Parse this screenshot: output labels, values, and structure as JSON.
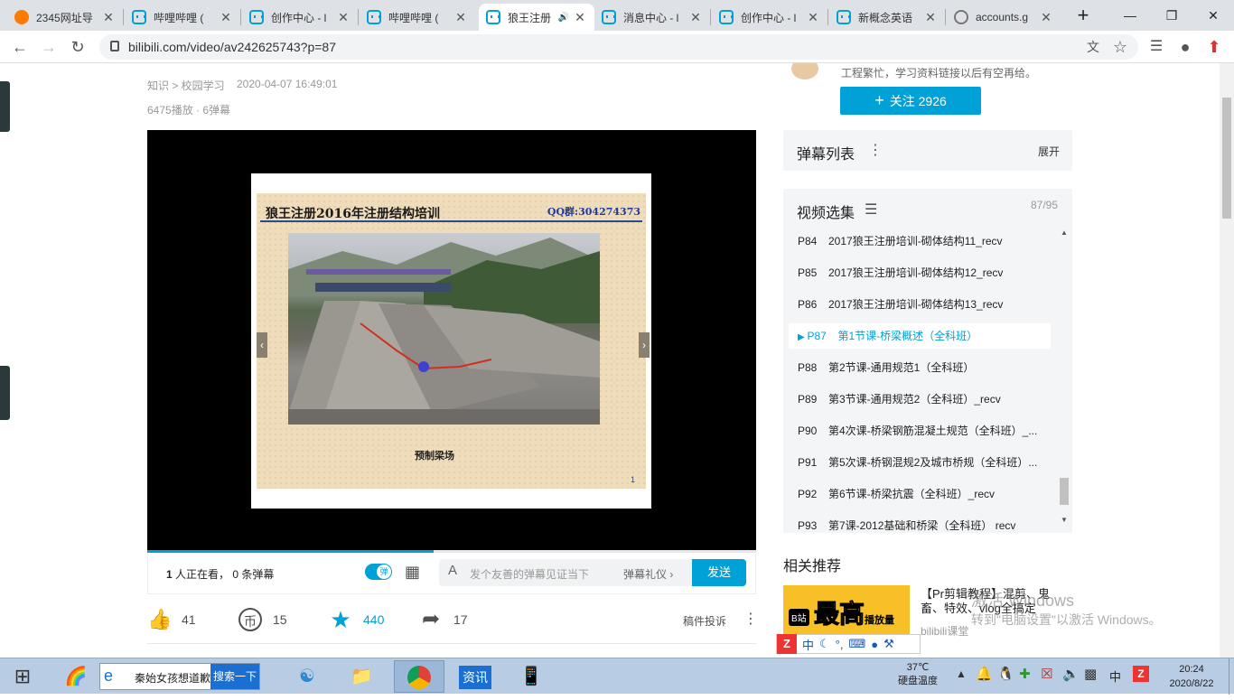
{
  "browser": {
    "tabs": [
      {
        "title": "2345网址导",
        "icon": "2345-icon"
      },
      {
        "title": "哔哩哔哩 (",
        "icon": "bilibili-icon"
      },
      {
        "title": "创作中心 - l",
        "icon": "bilibili-icon"
      },
      {
        "title": "哔哩哔哩 (",
        "icon": "bilibili-icon"
      },
      {
        "title": "狼王注册",
        "icon": "bilibili-icon",
        "active": true
      },
      {
        "title": "消息中心 - l",
        "icon": "bilibili-icon"
      },
      {
        "title": "创作中心 - l",
        "icon": "bilibili-icon"
      },
      {
        "title": "新概念英语",
        "icon": "bilibili-icon"
      },
      {
        "title": "accounts.g",
        "icon": "globe-icon"
      }
    ],
    "new_tab": "+",
    "url": "bilibili.com/video/av242625743?p=87"
  },
  "video": {
    "category": "知识 > 校园学习",
    "date": "2020-04-07 16:49:01",
    "stats": "6475播放 · 6弹幕",
    "slide": {
      "title": "狼王注册2016年注册结构培训",
      "qq": "QQ群:304274373",
      "caption": "预制梁场",
      "page": "1"
    },
    "progress": 0.47
  },
  "danmaku_bar": {
    "viewers": "1",
    "viewers_text": " 人正在看， ",
    "count_text": "0 条弹幕",
    "toggle": "弹",
    "placeholder": "发个友善的弹幕见证当下",
    "etiquette": "弹幕礼仪",
    "send": "发送"
  },
  "actions": {
    "like": "41",
    "coin": "15",
    "favorite": "440",
    "share": "17",
    "report": "稿件投诉"
  },
  "uploader": {
    "desc": "工程繁忙，学习资料链接以后有空再给。",
    "follow": "关注 2926"
  },
  "danmaku_list": {
    "title": "弹幕列表",
    "expand": "展开"
  },
  "episodes": {
    "title": "视频选集",
    "count": "87/95",
    "items": [
      {
        "p": "P84",
        "name": "2017狼王注册培训-砌体结构11_recv"
      },
      {
        "p": "P85",
        "name": "2017狼王注册培训-砌体结构12_recv"
      },
      {
        "p": "P86",
        "name": "2017狼王注册培训-砌体结构13_recv"
      },
      {
        "p": "P87",
        "name": "第1节课-桥梁概述（全科班）",
        "active": true
      },
      {
        "p": "P88",
        "name": "第2节课-通用规范1（全科班）"
      },
      {
        "p": "P89",
        "name": "第3节课-通用规范2（全科班）_recv"
      },
      {
        "p": "P90",
        "name": "第4次课-桥梁钢筋混凝土规范（全科班）_..."
      },
      {
        "p": "P91",
        "name": "第5次课-桥钢混规2及城市桥规（全科班）..."
      },
      {
        "p": "P92",
        "name": "第6节课-桥梁抗震（全科班）_recv"
      },
      {
        "p": "P93",
        "name": "第7课-2012基础和桥梁（全科班） recv"
      }
    ]
  },
  "recommend": {
    "title": "相关推荐",
    "video_title": "【Pr剪辑教程】混剪、鬼畜、特效、vlog全搞定",
    "author": "bilibili课堂",
    "thumb_text": "最高",
    "thumb_badge": "B站",
    "thumb_sub": "播放量"
  },
  "watermark": {
    "line1": "激活 Windows",
    "line2": "转到\"电脑设置\"以激活 Windows。"
  },
  "taskbar": {
    "search_text": "秦始女孩想道歉",
    "search_btn": "搜索一下",
    "news": "资讯",
    "temp": "37℃",
    "temp_label": "硬盘温度",
    "ime": "中",
    "time": "20:24",
    "date": "2020/8/22"
  },
  "colors": {
    "accent": "#00a1d6"
  }
}
